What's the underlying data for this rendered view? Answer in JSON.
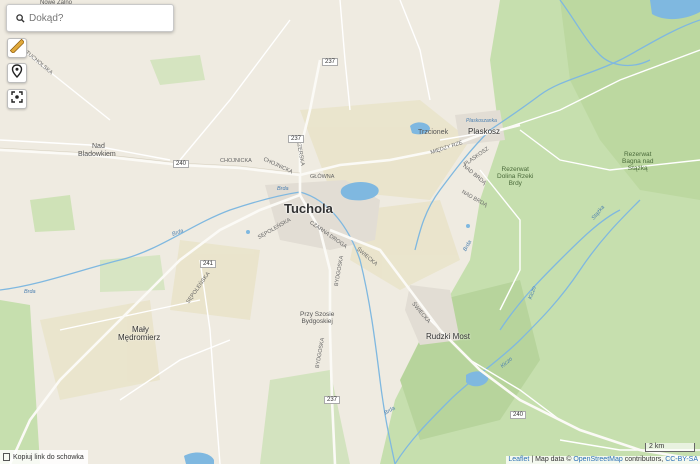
{
  "search": {
    "placeholder": "Dokąd?"
  },
  "controls": {
    "copy_link_label": "Kopiuj link do schowka"
  },
  "scale_label": "2 km",
  "attribution": {
    "leaflet": "Leaflet",
    "sep": " | Map data © ",
    "osm": "OpenStreetMap",
    "contrib": " contributors, ",
    "license": "CC-BY-SA"
  },
  "labels": {
    "tuchola": "Tuchola",
    "plaskosz": "Plaskosz",
    "rudzki_most": "Rudzki Most",
    "maly": "Mały",
    "medromierz": "Mędromierz",
    "nad": "Nad",
    "bladowkiem": "Bladowkiem",
    "trzcionek": "Trzcionek",
    "rez1_a": "Rezerwat",
    "rez1_b": "Dolina Rzeki",
    "rez1_c": "Brdy",
    "rez2_a": "Rezerwat",
    "rez2_b": "Bagna nad",
    "rez2_c": "Stążką",
    "przy_a": "Przy Szosie",
    "przy_b": "Bydgoskiej",
    "tucholska": "TUCHOLSKA",
    "chojnicka1": "CHOJNICKA",
    "chojnicka2": "CHOJNICKA",
    "glowna": "GŁÓWNA",
    "czerska": "CZERSKA",
    "miedzyrzecka": "MIĘDZY RZE",
    "plaskoszst": "PLASKOSZ",
    "nad_brda": "NAD BRDĄ",
    "nad_brda2": "NAD BRDĄ",
    "sepolenska": "SĘPOLEŃSKA",
    "sepolenska2": "SĘPOLEŃSKA",
    "czarna_droga": "CZARNA DROGA",
    "bydgoska": "BYDGOSKA",
    "swiecka": "ŚWIECKA",
    "swiecka2": "ŚWIECKA",
    "bydgoska2": "BYDGOSKA",
    "nowe_zalno": "Nowe Żalno",
    "brda1": "Brda",
    "brda2": "Brda",
    "brda3": "Brda",
    "brda4": "Brda",
    "brda5": "Brda",
    "kiczo": "Kiczo",
    "stazka": "Stążka",
    "kiczo2": "Kiczo",
    "plaskoszanka": "Plaskoszanka"
  },
  "route_shields": {
    "r237a": "237",
    "r237b": "237",
    "r237c": "237",
    "r240a": "240",
    "r240b": "240",
    "r241": "241"
  },
  "colors": {
    "forest": "#c8dfb0",
    "forest_dark": "#b9d6a0",
    "water": "#7fb8e0",
    "road": "#ffffff",
    "urban": "#e3ded6"
  }
}
